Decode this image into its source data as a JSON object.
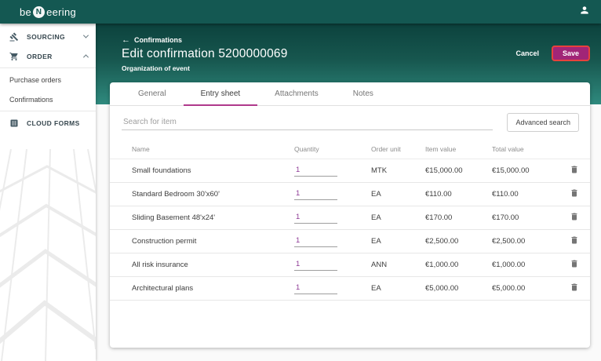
{
  "app": {
    "logo": {
      "prefix": "be",
      "n": "N",
      "suffix": "eering"
    }
  },
  "icons": {
    "back_arrow": "←"
  },
  "sidebar": {
    "sourcing": {
      "label": "SOURCING",
      "icon": "gavel-icon",
      "state": "collapsed"
    },
    "order": {
      "label": "ORDER",
      "icon": "cart-icon",
      "state": "expanded"
    },
    "order_items": [
      {
        "label": "Purchase orders"
      },
      {
        "label": "Confirmations"
      }
    ],
    "cloud_forms": {
      "label": "CLOUD FORMS",
      "icon": "forms-icon"
    }
  },
  "header": {
    "back_label": "Confirmations",
    "title": "Edit confirmation 5200000069",
    "subtitle": "Organization of event",
    "cancel_label": "Cancel",
    "save_label": "Save"
  },
  "tabs": [
    {
      "label": "General",
      "active": false
    },
    {
      "label": "Entry sheet",
      "active": true
    },
    {
      "label": "Attachments",
      "active": false
    },
    {
      "label": "Notes",
      "active": false
    }
  ],
  "search": {
    "placeholder": "Search for item",
    "advanced_label": "Advanced search"
  },
  "table": {
    "columns": [
      "Name",
      "Quantity",
      "Order unit",
      "Item value",
      "Total value"
    ],
    "rows": [
      {
        "name": "Small foundations",
        "quantity": "1",
        "order_unit": "MTK",
        "item_value": "€15,000.00",
        "total_value": "€15,000.00"
      },
      {
        "name": "Standard Bedroom 30'x60'",
        "quantity": "1",
        "order_unit": "EA",
        "item_value": "€110.00",
        "total_value": "€110.00"
      },
      {
        "name": "Sliding Basement 48'x24'",
        "quantity": "1",
        "order_unit": "EA",
        "item_value": "€170.00",
        "total_value": "€170.00"
      },
      {
        "name": "Construction permit",
        "quantity": "1",
        "order_unit": "EA",
        "item_value": "€2,500.00",
        "total_value": "€2,500.00"
      },
      {
        "name": "All risk insurance",
        "quantity": "1",
        "order_unit": "ANN",
        "item_value": "€1,000.00",
        "total_value": "€1,000.00"
      },
      {
        "name": "Architectural plans",
        "quantity": "1",
        "order_unit": "EA",
        "item_value": "€5,000.00",
        "total_value": "€5,000.00"
      }
    ]
  },
  "colors": {
    "topbar_teal": "#145852",
    "banner_teal_dark": "#0c423d",
    "banner_teal_light": "#2f8a7e",
    "save_magenta": "#a12577",
    "save_focus_ring": "#e8413c",
    "tab_underline_magenta": "#b03a8c",
    "quantity_purple": "#8e3a96"
  }
}
